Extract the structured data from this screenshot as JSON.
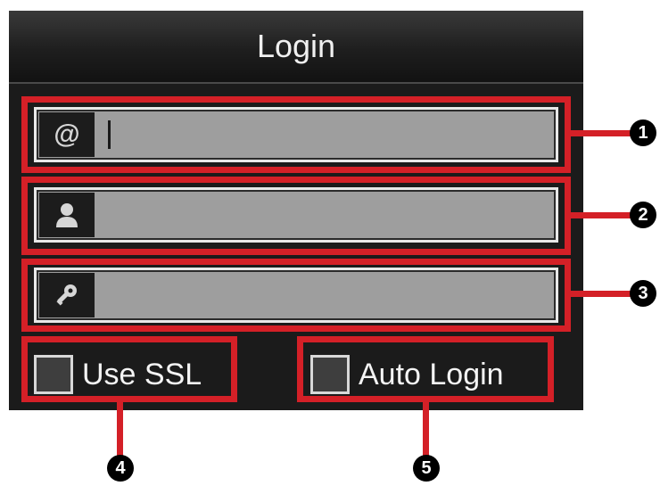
{
  "dialog": {
    "title": "Login",
    "fields": [
      {
        "icon": "at-icon",
        "value": ""
      },
      {
        "icon": "user-icon",
        "value": ""
      },
      {
        "icon": "key-icon",
        "value": ""
      }
    ],
    "options": {
      "use_ssl_label": "Use SSL",
      "use_ssl_checked": false,
      "auto_login_label": "Auto Login",
      "auto_login_checked": false
    }
  },
  "callouts": [
    "1",
    "2",
    "3",
    "4",
    "5"
  ],
  "colors": {
    "highlight": "#d42027",
    "panel": "#1b1b1b",
    "field": "#9e9e9e"
  }
}
